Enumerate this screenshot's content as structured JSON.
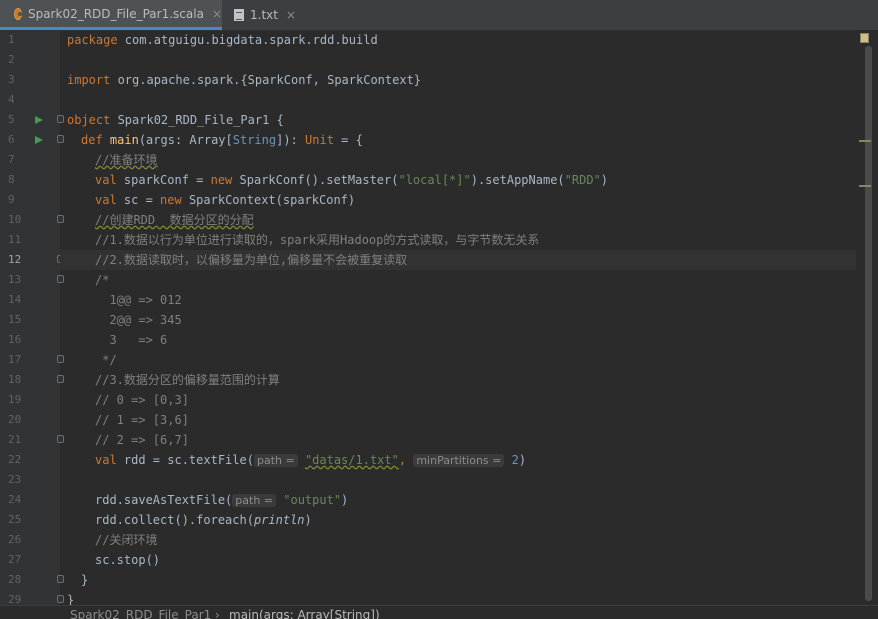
{
  "tabs": [
    {
      "label": "Spark02_RDD_File_Par1.scala",
      "close": "×",
      "active": true,
      "icon": "scala-file-icon"
    },
    {
      "label": "1.txt",
      "close": "×",
      "active": false,
      "icon": "text-file-icon"
    }
  ],
  "line_numbers": [
    "1",
    "2",
    "3",
    "4",
    "5",
    "6",
    "7",
    "8",
    "9",
    "10",
    "11",
    "12",
    "13",
    "14",
    "15",
    "16",
    "17",
    "18",
    "19",
    "20",
    "21",
    "22",
    "23",
    "24",
    "25",
    "26",
    "27",
    "28",
    "29"
  ],
  "current_line": "12",
  "code": {
    "l1_kw": "package",
    "l1_rest": " com.atguigu.bigdata.spark.rdd.build",
    "l3_kw": "import",
    "l3_rest": " org.apache.spark.{SparkConf, SparkContext}",
    "l5_kw": "object",
    "l5_rest": " Spark02_RDD_File_Par1 {",
    "l6_def": "def",
    "l6_fn": "main",
    "l6_a": "(args: Array[",
    "l6_type": "String",
    "l6_b": "]): ",
    "l6_unit": "Unit",
    "l6_c": " = {",
    "l7": "//准备环境",
    "l8_val": "val",
    "l8_a": " sparkConf = ",
    "l8_new": "new",
    "l8_b": " SparkConf().setMaster(",
    "l8_s1": "\"local[*]\"",
    "l8_c": ").setAppName(",
    "l8_s2": "\"RDD\"",
    "l8_d": ")",
    "l9_val": "val",
    "l9_a": " sc = ",
    "l9_new": "new",
    "l9_b": " SparkContext(sparkConf)",
    "l10": "//创建RDD  数据分区的分配",
    "l11": "//1.数据以行为单位进行读取的，spark采用Hadoop的方式读取，与字节数无关系",
    "l12": "//2.数据读取时，以偏移量为单位,偏移量不会被重复读取",
    "l13": "/*",
    "l14": "  1@@ => 012",
    "l15": "  2@@ => 345",
    "l16": "  3   => 6",
    "l17": " */",
    "l18": "//3.数据分区的偏移量范围的计算",
    "l19": "// 0 => [0,3]",
    "l20": "// 1 => [3,6]",
    "l21": "// 2 => [6,7]",
    "l22_val": "val",
    "l22_a": " rdd = sc.textFile(",
    "l22_hint1": "path =",
    "l22_s": "\"datas/1.txt\"",
    "l22_comma": ",",
    "l22_hint2": "minPartitions =",
    "l22_num": "2",
    "l22_end": ")",
    "l24_a": "rdd.saveAsTextFile(",
    "l24_hint": "path =",
    "l24_s": "\"output\"",
    "l24_end": ")",
    "l25_a": "rdd.collect().foreach(",
    "l25_fn": "println",
    "l25_end": ")",
    "l26": "//关闭环境",
    "l27": "sc.stop()",
    "l28": "}",
    "l29": "}"
  },
  "breadcrumb": {
    "item1": "Spark02_RDD_File_Par1",
    "sep": "›",
    "item2": "main(args: Array[String])"
  },
  "colors": {
    "keyword": "#cc7832",
    "string": "#6a8759",
    "comment": "#808080",
    "function": "#ffc66d",
    "number": "#6897bb",
    "background": "#2b2b2b"
  }
}
